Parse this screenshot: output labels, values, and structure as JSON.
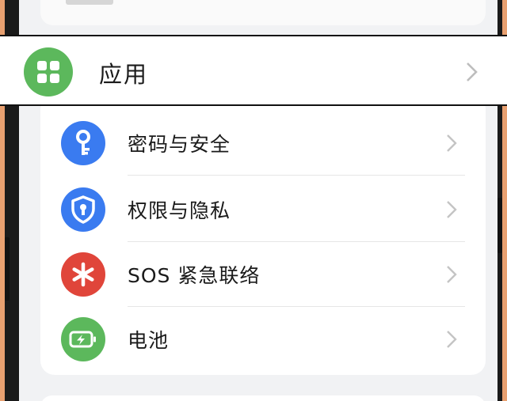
{
  "highlight": {
    "label": "应用",
    "icon": "apps-grid-icon",
    "icon_color": "#5cb85c"
  },
  "settings_items": [
    {
      "label": "密码与安全",
      "icon": "key-icon",
      "icon_color": "#3a7bf0"
    },
    {
      "label": "权限与隐私",
      "icon": "shield-lock-icon",
      "icon_color": "#3a7bf0"
    },
    {
      "label": "SOS 紧急联络",
      "icon": "asterisk-sos-icon",
      "icon_color": "#e0453a"
    },
    {
      "label": "电池",
      "icon": "battery-charging-icon",
      "icon_color": "#5cb85c"
    }
  ],
  "colors": {
    "background": "#f1f2f4",
    "card": "#ffffff",
    "chevron": "#c4c4c4"
  }
}
